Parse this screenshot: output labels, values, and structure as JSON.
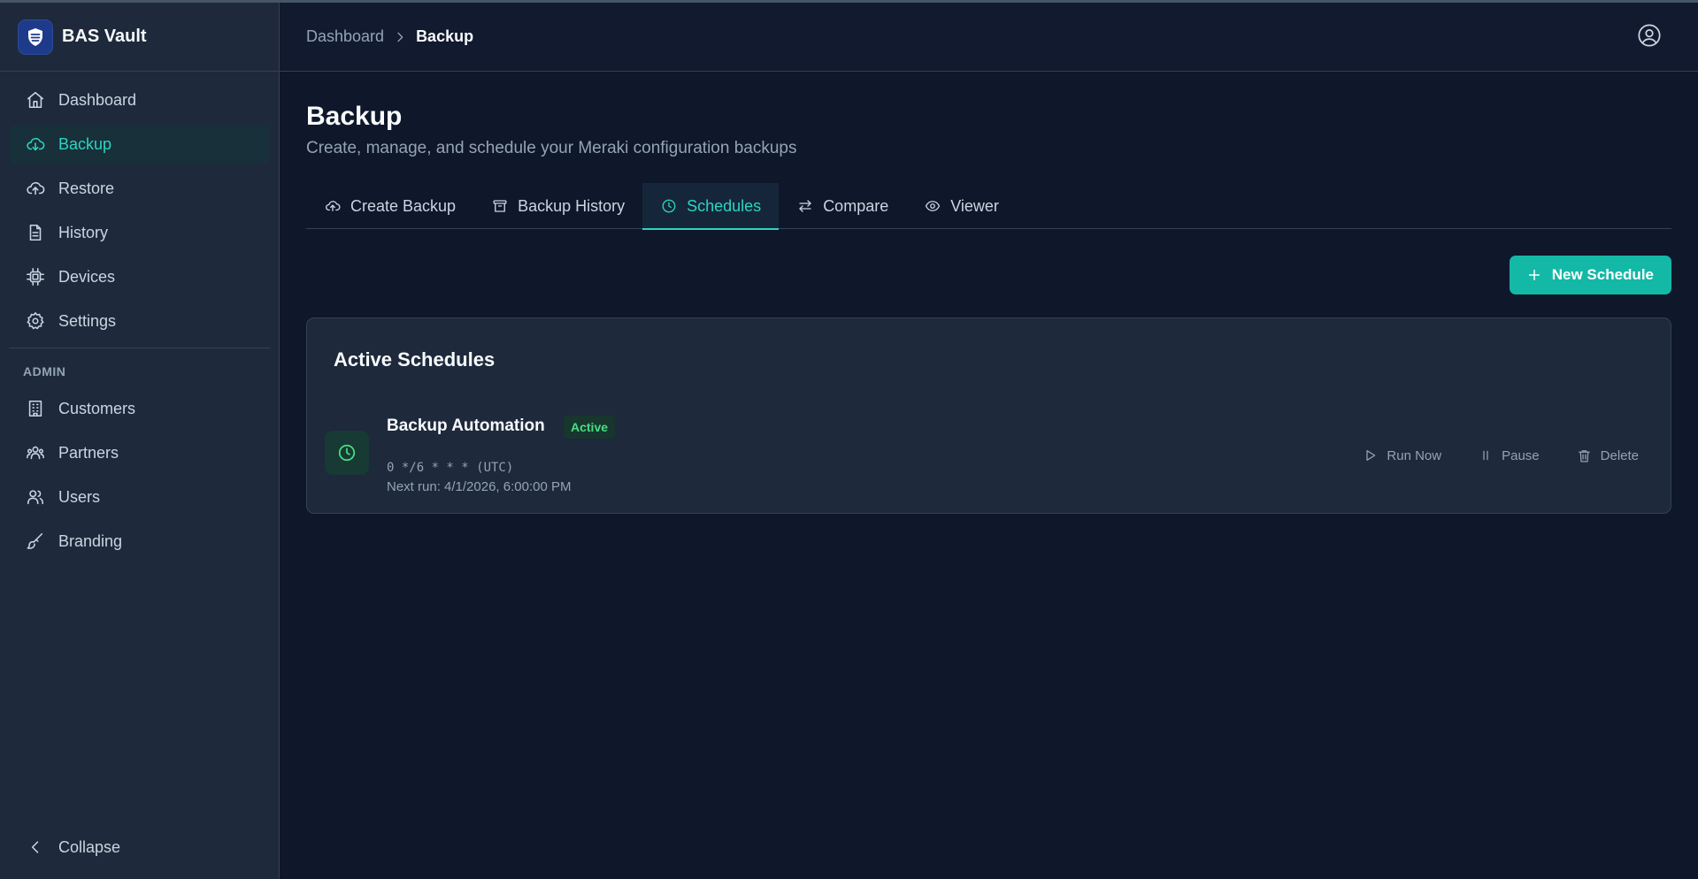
{
  "app": {
    "name": "BAS Vault"
  },
  "colors": {
    "accent": "#2dd4bf",
    "primary_button": "#14b8a6",
    "active_badge": "#4ade80",
    "background": "#0f172a",
    "sidebar": "#1e293b"
  },
  "sidebar": {
    "items": [
      {
        "label": "Dashboard",
        "icon": "home-icon"
      },
      {
        "label": "Backup",
        "icon": "cloud-download-icon",
        "active": true
      },
      {
        "label": "Restore",
        "icon": "cloud-upload-icon"
      },
      {
        "label": "History",
        "icon": "file-text-icon"
      },
      {
        "label": "Devices",
        "icon": "chip-icon"
      },
      {
        "label": "Settings",
        "icon": "gear-icon"
      }
    ],
    "admin_section": "ADMIN",
    "admin_items": [
      {
        "label": "Customers",
        "icon": "building-icon"
      },
      {
        "label": "Partners",
        "icon": "users-group-icon"
      },
      {
        "label": "Users",
        "icon": "users-icon"
      },
      {
        "label": "Branding",
        "icon": "brush-icon"
      }
    ],
    "collapse_label": "Collapse"
  },
  "header": {
    "breadcrumb": [
      "Dashboard",
      "Backup"
    ]
  },
  "page": {
    "title": "Backup",
    "subtitle": "Create, manage, and schedule your Meraki configuration backups"
  },
  "tabs": [
    {
      "label": "Create Backup",
      "icon": "cloud-upload-icon"
    },
    {
      "label": "Backup History",
      "icon": "archive-icon"
    },
    {
      "label": "Schedules",
      "icon": "clock-icon",
      "active": true
    },
    {
      "label": "Compare",
      "icon": "swap-arrows-icon"
    },
    {
      "label": "Viewer",
      "icon": "eye-icon"
    }
  ],
  "toolbar": {
    "new_schedule_label": "New Schedule"
  },
  "schedules": {
    "title": "Active Schedules",
    "items": [
      {
        "name": "Backup Automation",
        "status": "Active",
        "cron": "0 */6 * * * (UTC)",
        "next_run": "Next run: 4/1/2026, 6:00:00 PM",
        "actions": {
          "run_now": "Run Now",
          "pause": "Pause",
          "delete": "Delete"
        }
      }
    ]
  }
}
